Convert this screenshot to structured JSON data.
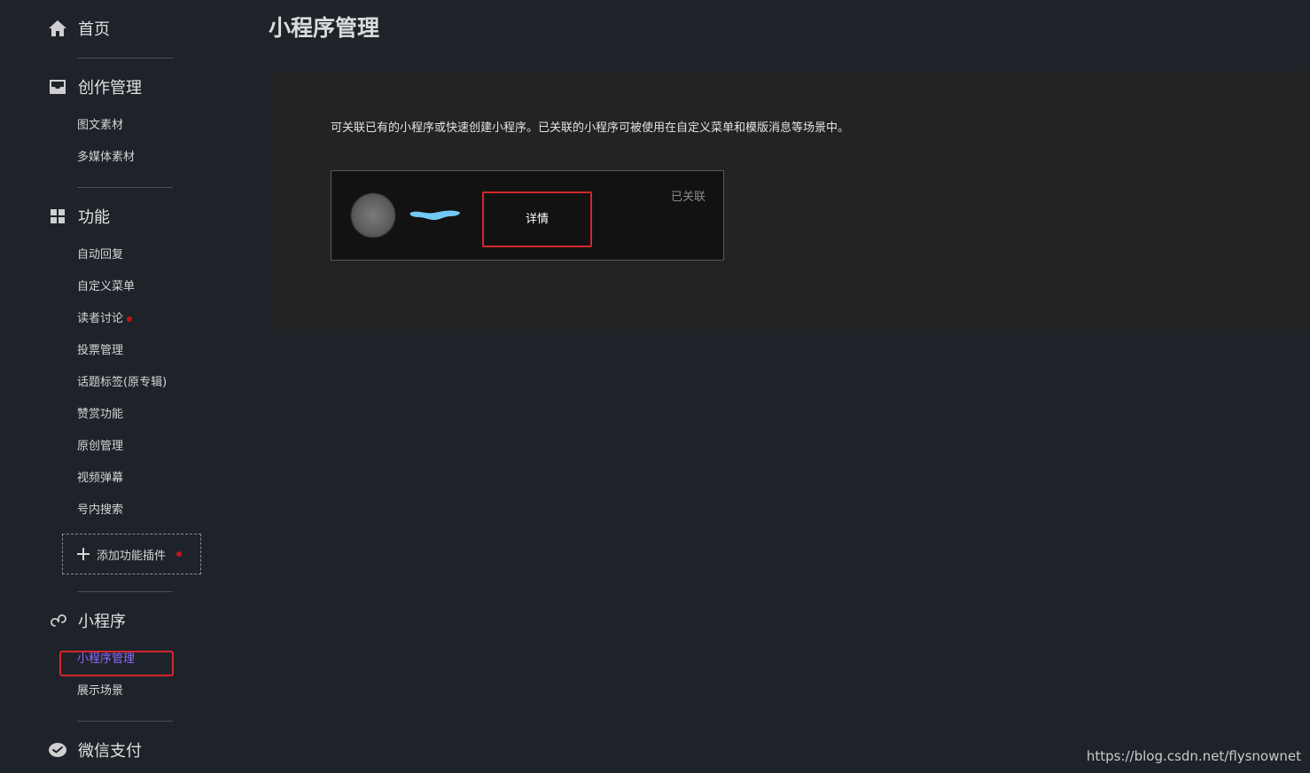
{
  "sidebar": {
    "home": {
      "label": "首页"
    },
    "creation": {
      "label": "创作管理",
      "items": [
        "图文素材",
        "多媒体素材"
      ]
    },
    "features": {
      "label": "功能",
      "items": [
        "自动回复",
        "自定义菜单",
        "读者讨论",
        "投票管理",
        "话题标签(原专辑)",
        "赞赏功能",
        "原创管理",
        "视频弹幕",
        "号内搜索"
      ],
      "add_plugin": "添加功能插件"
    },
    "miniprogram": {
      "label": "小程序",
      "items": [
        "小程序管理",
        "展示场景"
      ]
    },
    "wechat_pay": {
      "label": "微信支付"
    }
  },
  "main": {
    "title": "小程序管理",
    "description": "可关联已有的小程序或快速创建小程序。已关联的小程序可被使用在自定义菜单和模版消息等场景中。",
    "card": {
      "detail_label": "详情",
      "status": "已关联"
    }
  },
  "watermark": "https://blog.csdn.net/flysnownet",
  "colors": {
    "background": "#1e232a",
    "panel": "#232324",
    "card": "#121212",
    "active": "#8e6bff",
    "highlight": "#d4262c",
    "name_blur": "#73c9f5"
  }
}
